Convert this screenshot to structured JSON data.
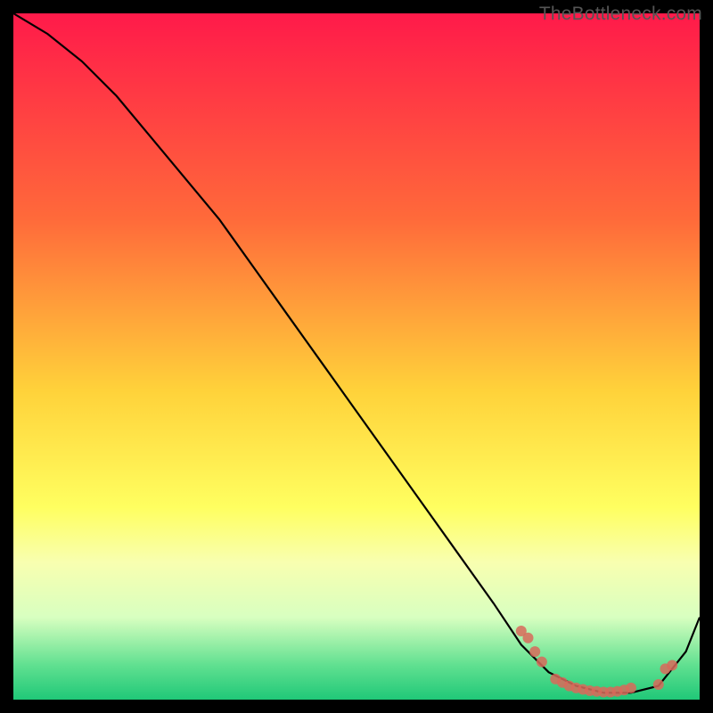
{
  "watermark": "TheBottleneck.com",
  "chart_data": {
    "type": "line",
    "title": "",
    "xlabel": "",
    "ylabel": "",
    "xlim": [
      0,
      100
    ],
    "ylim": [
      0,
      100
    ],
    "background_gradient": {
      "stops": [
        {
          "offset": 0,
          "color": "#ff1a4a"
        },
        {
          "offset": 30,
          "color": "#ff6a3a"
        },
        {
          "offset": 55,
          "color": "#ffd23a"
        },
        {
          "offset": 72,
          "color": "#ffff60"
        },
        {
          "offset": 80,
          "color": "#f8ffb0"
        },
        {
          "offset": 88,
          "color": "#d8ffc0"
        },
        {
          "offset": 95,
          "color": "#60e090"
        },
        {
          "offset": 100,
          "color": "#20c878"
        }
      ]
    },
    "series": [
      {
        "name": "curve",
        "color": "#000000",
        "x": [
          0,
          5,
          10,
          15,
          20,
          25,
          30,
          35,
          40,
          45,
          50,
          55,
          60,
          65,
          70,
          74,
          78,
          82,
          86,
          90,
          94,
          98,
          100
        ],
        "y": [
          100,
          97,
          93,
          88,
          82,
          76,
          70,
          63,
          56,
          49,
          42,
          35,
          28,
          21,
          14,
          8,
          4,
          2,
          1,
          1,
          2,
          7,
          12
        ]
      }
    ],
    "markers": {
      "color": "#d86a5a",
      "radius": 6,
      "points": [
        {
          "x": 74,
          "y": 10
        },
        {
          "x": 75,
          "y": 9
        },
        {
          "x": 76,
          "y": 7
        },
        {
          "x": 77,
          "y": 5.5
        },
        {
          "x": 79,
          "y": 3.0
        },
        {
          "x": 80,
          "y": 2.5
        },
        {
          "x": 81,
          "y": 2.0
        },
        {
          "x": 82,
          "y": 1.7
        },
        {
          "x": 83,
          "y": 1.5
        },
        {
          "x": 84,
          "y": 1.3
        },
        {
          "x": 85,
          "y": 1.2
        },
        {
          "x": 86,
          "y": 1.1
        },
        {
          "x": 87,
          "y": 1.1
        },
        {
          "x": 88,
          "y": 1.2
        },
        {
          "x": 89,
          "y": 1.4
        },
        {
          "x": 90,
          "y": 1.7
        },
        {
          "x": 94,
          "y": 2.2
        },
        {
          "x": 95,
          "y": 4.5
        },
        {
          "x": 96,
          "y": 5.0
        }
      ]
    }
  }
}
